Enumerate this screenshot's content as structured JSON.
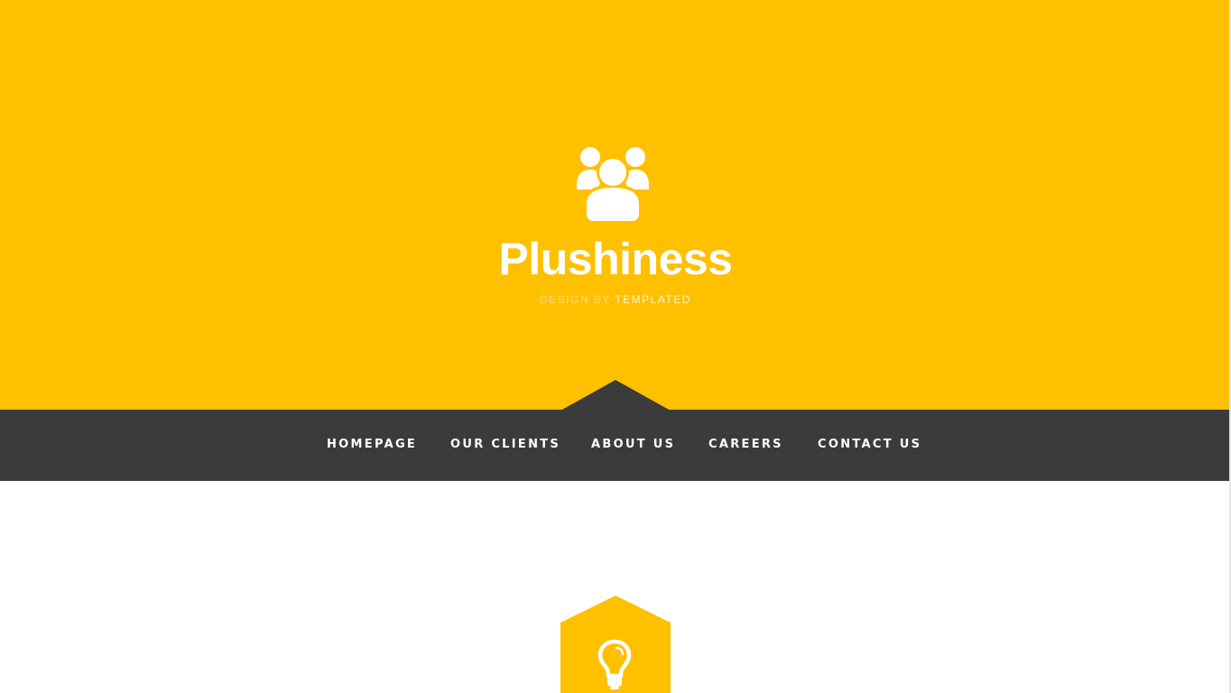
{
  "site": {
    "title": "Plushiness",
    "credit_prefix": "DESIGN BY",
    "credit_link": "TEMPLATED",
    "logo_icon": "users-icon"
  },
  "nav": {
    "items": [
      {
        "label": "HOMEPAGE"
      },
      {
        "label": "OUR CLIENTS"
      },
      {
        "label": "ABOUT US"
      },
      {
        "label": "CAREERS"
      },
      {
        "label": "CONTACT US"
      }
    ]
  },
  "feature": {
    "icon": "lightbulb-icon"
  },
  "colors": {
    "accent": "#ffc000",
    "nav_background": "#3b3b3b",
    "text_on_accent": "#ffffff",
    "page_background": "#ffffff"
  }
}
